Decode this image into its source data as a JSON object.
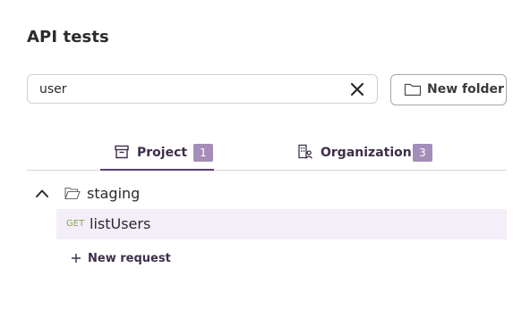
{
  "page": {
    "title": "API tests"
  },
  "search": {
    "value": "user",
    "placeholder": ""
  },
  "new_folder_button": {
    "label": "New folder"
  },
  "tabs": [
    {
      "label": "Project",
      "count": "1",
      "icon": "archive-box-icon",
      "active": true
    },
    {
      "label": "Organization",
      "count": "3",
      "icon": "building-user-icon",
      "active": false
    }
  ],
  "tree": {
    "folder": {
      "name": "staging",
      "expanded": true,
      "icon": "folder-open-icon"
    },
    "requests": [
      {
        "method": "GET",
        "name": "listUsers",
        "selected": true
      }
    ],
    "new_request_label": "New request"
  },
  "colors": {
    "accent": "#5a3e6e",
    "badge": "#a48db8",
    "selected_row": "#f3eef7",
    "method_get": "#8aa25e"
  }
}
